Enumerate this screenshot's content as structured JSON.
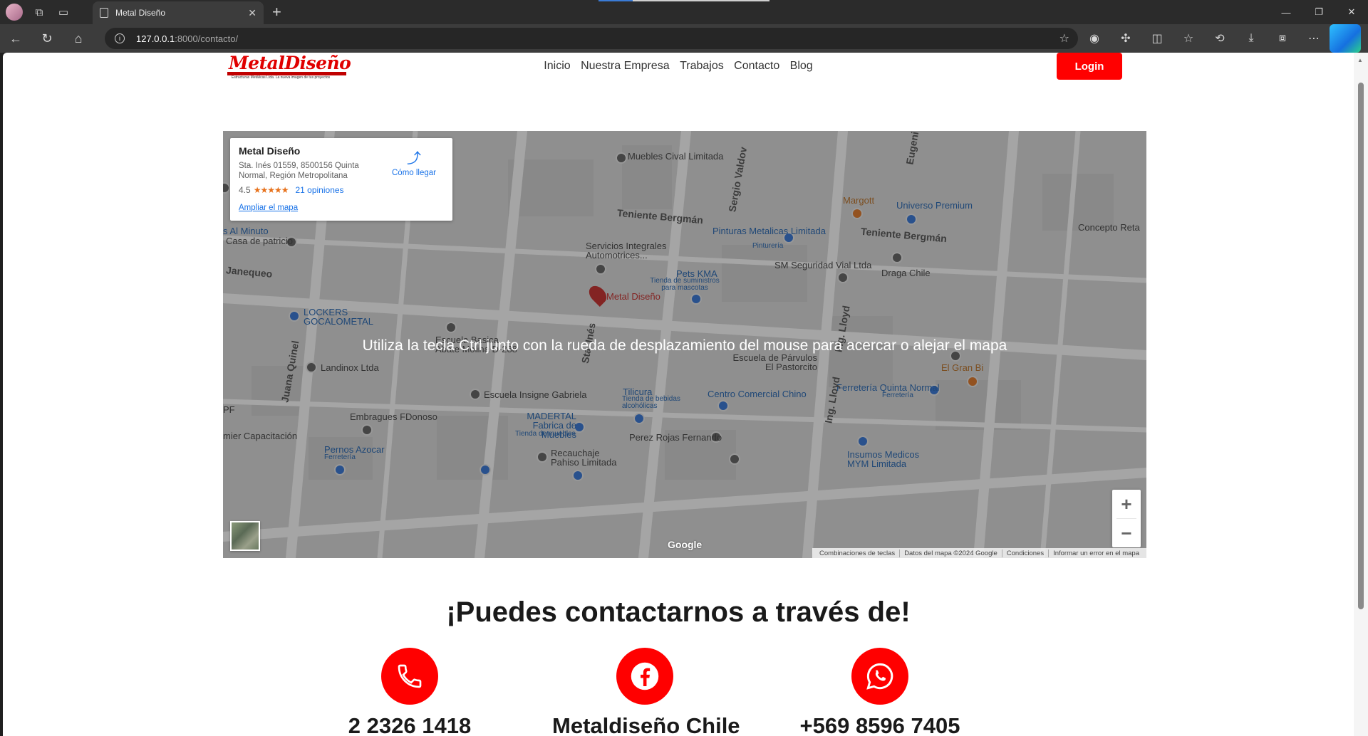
{
  "browser": {
    "tab_title": "Metal Diseño",
    "url_host": "127.0.0.1",
    "url_rest": ":8000/contacto/"
  },
  "site": {
    "logo_text": "MetalDiseño",
    "logo_tagline": "Estructuras Metálicas Ltda.   La nueva imagen de tus proyectos",
    "nav": [
      "Inicio",
      "Nuestra Empresa",
      "Trabajos",
      "Contacto",
      "Blog"
    ],
    "login_label": "Login",
    "accent_color": "#ff0000"
  },
  "map": {
    "place_name": "Metal Diseño",
    "address": "Sta. Inés 01559, 8500156 Quinta Normal, Región Metropolitana",
    "rating": "4.5",
    "stars": "★★★★★",
    "reviews": "21 opiniones",
    "directions_label": "Cómo llegar",
    "enlarge_label": "Ampliar el mapa",
    "ctrl_message": "Utiliza la tecla Ctrl junto con la rueda de desplazamiento del mouse para acercar o alejar el mapa",
    "zoom_in": "+",
    "zoom_out": "−",
    "google": "Google",
    "attribution": [
      "Combinaciones de teclas",
      "Datos del mapa ©2024 Google",
      "Condiciones",
      "Informar un error en el mapa"
    ],
    "labels": {
      "muebles_cival": "Muebles Cival Limitada",
      "teniente_bergman_1": "Teniente Bergmán",
      "teniente_bergman_2": "Teniente Bergmán",
      "margott": "Margott",
      "universo_premium": "Universo Premium",
      "concepto_reta": "Concepto Reta",
      "al_minuto": "s Al Minuto",
      "casa_patricio": "Casa de patricio",
      "pinturas": "Pinturas Metalicas Limitada",
      "pintureria": "Pinturería",
      "servicios": "Servicios Integrales Automotrices...",
      "sm_seguridad": "SM Seguridad Vial Ltda",
      "draga": "Draga Chile",
      "janequeo": "Janequeo",
      "pets_kma": "Pets KMA",
      "pets_sub": "Tienda de suministros para mascotas",
      "metal_diseno_pin": "Metal Diseño",
      "lockers": "LOCKERS GOCALOMETAL",
      "escuela_basica": "Escuela Basica Abate Molina D-288",
      "escuela_parvulos": "Escuela de Párvulos El Pastorcito",
      "landinox": "Landinox Ltda",
      "el_gran": "El Gran Bi",
      "ferreteria_qn": "Ferretería Quinta Normal",
      "ferreteria_sub": "Ferretería",
      "escuela_insigne": "Escuela Insigne Gabriela",
      "tilicura": "Tilicura",
      "tilicura_sub": "Tienda de bebidas alcohólicas",
      "centro_comercial": "Centro Comercial Chino",
      "embragues": "Embragues FDonoso",
      "madertal": "MADERTAL Fabrica de Muebles",
      "madertal_sub": "Tienda de muebles",
      "capacitacion": "mier Capacitación",
      "perez_rojas": "Perez Rojas Fernando",
      "pernos": "Pernos Azocar",
      "pernos_sub": "Ferretería",
      "recauchaje": "Recauchaje Pahiso Limitada",
      "insumos": "Insumos Medicos MYM Limitada",
      "sergio_valdovinos": "Sergio Valdov",
      "juana_quinel": "Juana Quinel",
      "sta_ines": "Sta. Inés",
      "ing_lloyd_1": "Ing. Lloyd",
      "ing_lloyd_2": "Ing. Lloyd",
      "eugenio": "Eugeni",
      "pf": "PF"
    }
  },
  "contact": {
    "title": "¡Puedes contactarnos a través de!",
    "items": [
      {
        "icon": "phone-icon",
        "text": "2 2326 1418"
      },
      {
        "icon": "facebook-icon",
        "text": "Metaldiseño Chile"
      },
      {
        "icon": "whatsapp-icon",
        "text": "+569 8596 7405"
      }
    ]
  }
}
